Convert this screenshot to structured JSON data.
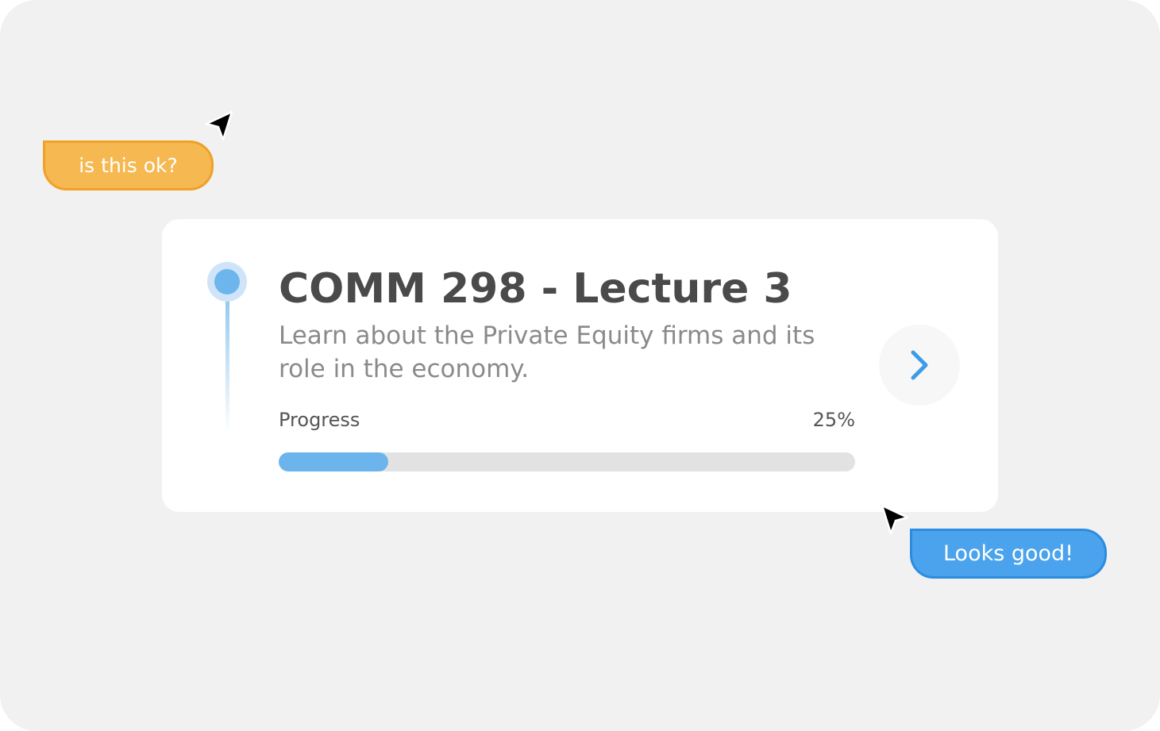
{
  "comments": {
    "question": "is this ok?",
    "reply": "Looks good!"
  },
  "card": {
    "title": "COMM 298 - Lecture 3",
    "description": "Learn about the Private Equity firms and its role in the economy.",
    "progress_label": "Progress",
    "progress_text": "25%",
    "progress_fraction": 0.19
  },
  "icons": {
    "cursor": "cursor-arrow-icon",
    "next": "chevron-right-icon",
    "timeline": "timeline-marker-icon"
  },
  "colors": {
    "question_bubble": "#f6b850",
    "reply_bubble": "#4aa3ec",
    "accent_blue": "#6cb4ec",
    "chevron": "#3d9be9"
  }
}
